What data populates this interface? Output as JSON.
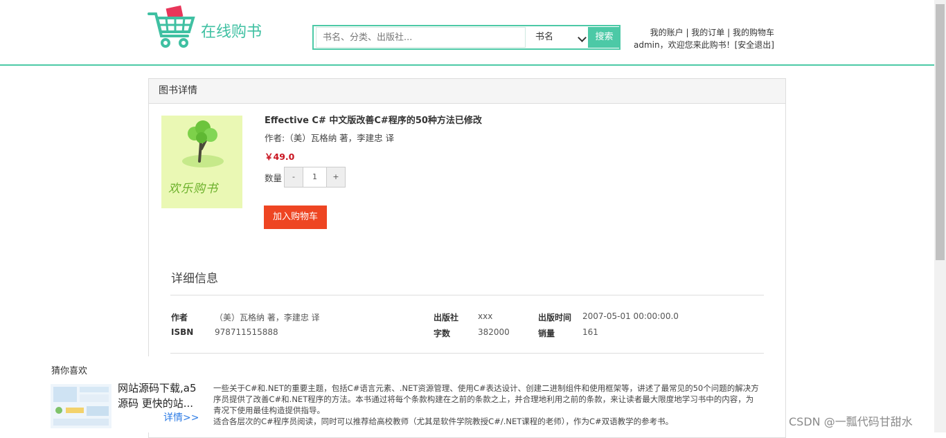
{
  "header": {
    "logo_text": "在线购书",
    "search": {
      "placeholder": "书名、分类、出版社...",
      "select_value": "书名",
      "button": "搜索"
    },
    "account_links": [
      "我的账户",
      "我的订单",
      "我的购物车"
    ],
    "welcome": "admin，欢迎您来此购书！",
    "logout": "[安全退出]"
  },
  "panel": {
    "title": "图书详情",
    "cover_text": "欢乐购书",
    "book": {
      "title": "Effective C# 中文版改善C#程序的50种方法已修改",
      "author": "作者:（美）瓦格纳 著，李建忠 译",
      "price": "￥49.0",
      "qty_label": "数量",
      "qty_value": "1",
      "minus": "-",
      "plus": "+",
      "add_cart": "加入购物车"
    },
    "detail": {
      "heading": "详细信息",
      "author_label": "作者",
      "author_value": "（美）瓦格纳 著，李建忠 译",
      "publisher_label": "出版社",
      "publisher_value": "xxx",
      "pubtime_label": "出版时间",
      "pubtime_value": "2007-05-01 00:00:00.0",
      "isbn_label": "ISBN",
      "isbn_value": "978711515888",
      "words_label": "字数",
      "words_value": "382000",
      "sales_label": "销量",
      "sales_value": "161"
    }
  },
  "recommend": {
    "title": "猜你喜欢",
    "item_title": "网站源码下载,a5源码 更快的站...",
    "more": "详情>>",
    "description": [
      "一些关于C#和.NET的重要主题，包括C#语言元素、.NET资源管理、使用C#表达设计、创建二进制组件和使用框架等，讲述了最常见的50个问题的解决方",
      "序员提供了改善C#和.NET程序的方法。本书通过将每个条款构建在之前的条款之上，并合理地利用之前的条款，来让读者最大限度地学习书中的内容，为",
      "青况下使用最佳构造提供指导。",
      "适合各层次的C#程序员阅读，同时可以推荐给高校教师（尤其是软件学院教授C#/.NET课程的老师），作为C#双语教学的参考书。"
    ]
  },
  "watermark": "CSDN @一瓢代码甘甜水",
  "colors": {
    "accent": "#4cc9a6",
    "price": "#c9131f",
    "cart_button": "#ee4522",
    "link": "#2c7be5"
  }
}
